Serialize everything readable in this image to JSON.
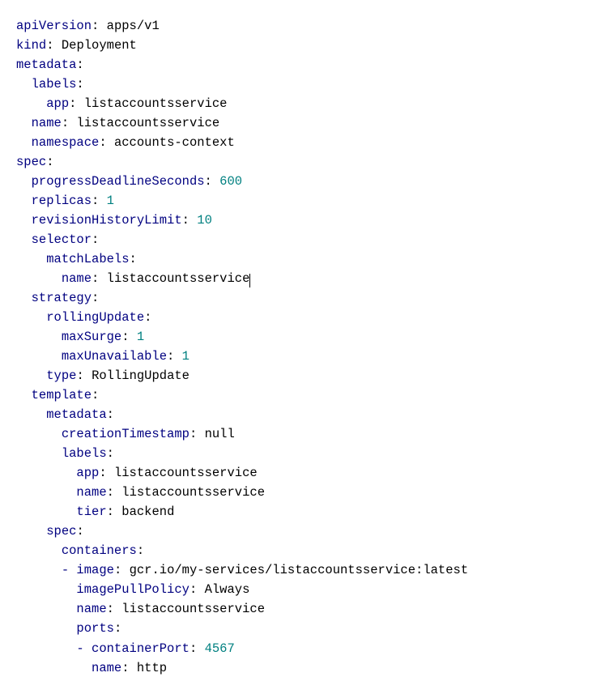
{
  "lines": [
    {
      "indent": 0,
      "key": "apiVersion",
      "val": "apps/v1",
      "valType": "str"
    },
    {
      "indent": 0,
      "key": "kind",
      "val": "Deployment",
      "valType": "str"
    },
    {
      "indent": 0,
      "key": "metadata",
      "val": "",
      "valType": "none"
    },
    {
      "indent": 1,
      "key": "labels",
      "val": "",
      "valType": "none"
    },
    {
      "indent": 2,
      "key": "app",
      "val": "listaccountsservice",
      "valType": "str"
    },
    {
      "indent": 1,
      "key": "name",
      "val": "listaccountsservice",
      "valType": "str"
    },
    {
      "indent": 1,
      "key": "namespace",
      "val": "accounts-context",
      "valType": "str"
    },
    {
      "indent": 0,
      "key": "spec",
      "val": "",
      "valType": "none"
    },
    {
      "indent": 1,
      "key": "progressDeadlineSeconds",
      "val": "600",
      "valType": "num"
    },
    {
      "indent": 1,
      "key": "replicas",
      "val": "1",
      "valType": "num"
    },
    {
      "indent": 1,
      "key": "revisionHistoryLimit",
      "val": "10",
      "valType": "num"
    },
    {
      "indent": 1,
      "key": "selector",
      "val": "",
      "valType": "none"
    },
    {
      "indent": 2,
      "key": "matchLabels",
      "val": "",
      "valType": "none"
    },
    {
      "indent": 3,
      "key": "name",
      "val": "listaccountsservice",
      "valType": "str",
      "cursor": true
    },
    {
      "indent": 1,
      "key": "strategy",
      "val": "",
      "valType": "none"
    },
    {
      "indent": 2,
      "key": "rollingUpdate",
      "val": "",
      "valType": "none"
    },
    {
      "indent": 3,
      "key": "maxSurge",
      "val": "1",
      "valType": "num"
    },
    {
      "indent": 3,
      "key": "maxUnavailable",
      "val": "1",
      "valType": "num"
    },
    {
      "indent": 2,
      "key": "type",
      "val": "RollingUpdate",
      "valType": "str"
    },
    {
      "indent": 1,
      "key": "template",
      "val": "",
      "valType": "none"
    },
    {
      "indent": 2,
      "key": "metadata",
      "val": "",
      "valType": "none"
    },
    {
      "indent": 3,
      "key": "creationTimestamp",
      "val": "null",
      "valType": "str"
    },
    {
      "indent": 3,
      "key": "labels",
      "val": "",
      "valType": "none"
    },
    {
      "indent": 4,
      "key": "app",
      "val": "listaccountsservice",
      "valType": "str"
    },
    {
      "indent": 4,
      "key": "name",
      "val": "listaccountsservice",
      "valType": "str"
    },
    {
      "indent": 4,
      "key": "tier",
      "val": "backend",
      "valType": "str"
    },
    {
      "indent": 2,
      "key": "spec",
      "val": "",
      "valType": "none"
    },
    {
      "indent": 3,
      "key": "containers",
      "val": "",
      "valType": "none"
    },
    {
      "indent": 3,
      "dash": true,
      "key": "image",
      "val": "gcr.io/my-services/listaccountsservice:latest",
      "valType": "str"
    },
    {
      "indent": 4,
      "key": "imagePullPolicy",
      "val": "Always",
      "valType": "str"
    },
    {
      "indent": 4,
      "key": "name",
      "val": "listaccountsservice",
      "valType": "str"
    },
    {
      "indent": 4,
      "key": "ports",
      "val": "",
      "valType": "none"
    },
    {
      "indent": 4,
      "dash": true,
      "key": "containerPort",
      "val": "4567",
      "valType": "num"
    },
    {
      "indent": 5,
      "key": "name",
      "val": "http",
      "valType": "str"
    }
  ]
}
